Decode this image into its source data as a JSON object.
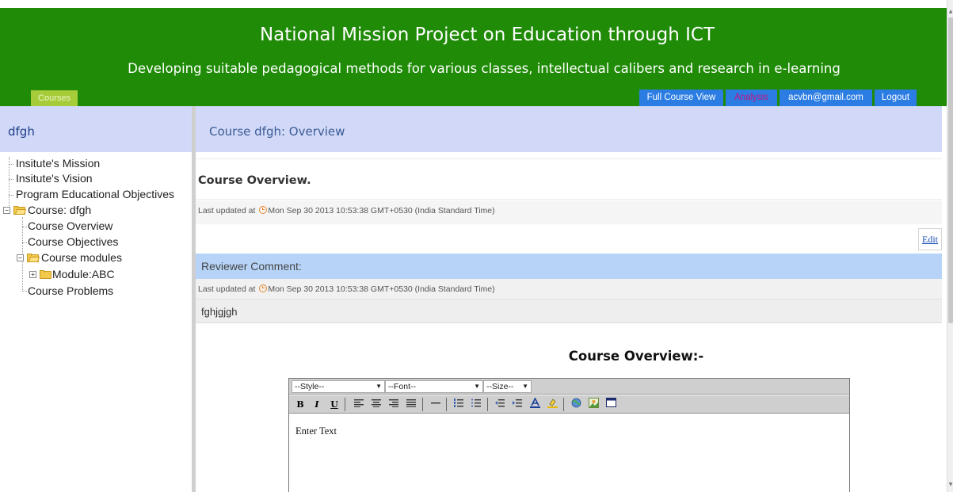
{
  "header": {
    "title": "National Mission Project on Education through ICT",
    "subtitle": "Developing suitable pedagogical methods for various classes, intellectual calibers and research in e-learning",
    "courses_tab": "Courses",
    "nav": {
      "full_course_view": "Full Course View",
      "analysis": "Analysis",
      "email": "acvbn@gmail.com",
      "logout": "Logout"
    }
  },
  "sidebar": {
    "title": "dfgh",
    "tree": {
      "mission": "Insitute's Mission",
      "vision": "Insitute's Vision",
      "peo": "Program Educational Objectives",
      "course": "Course: dfgh",
      "course_overview": "Course Overview",
      "course_objectives": "Course Objectives",
      "course_modules": "Course modules",
      "module": "Module:ABC",
      "course_problems": "Course Problems"
    }
  },
  "main": {
    "title": "Course dfgh: Overview",
    "overview_heading": "Course Overview.",
    "last_updated_label": "Last updated at",
    "last_updated_1": "Mon Sep 30 2013 10:53:38 GMT+0530 (India Standard Time)",
    "edit_label": "Edit",
    "reviewer_label": "Reviewer Comment:",
    "last_updated_2": "Mon Sep 30 2013 10:53:38 GMT+0530 (India Standard Time)",
    "comment_text": "fghjgjgh",
    "editor_heading": "Course Overview:-"
  },
  "editor": {
    "style": "--Style--",
    "font": "--Font--",
    "size": "--Size--",
    "toolbar": {
      "bold": "B",
      "italic": "I",
      "underline": "U"
    },
    "body_text": "Enter Text"
  },
  "colors": {
    "header_green": "#1f8b06",
    "nav_blue": "#2c7de3",
    "courses_tab": "#a6cc3a",
    "panel_header": "#d2d9f8",
    "reviewer_band": "#b7d4f8"
  }
}
